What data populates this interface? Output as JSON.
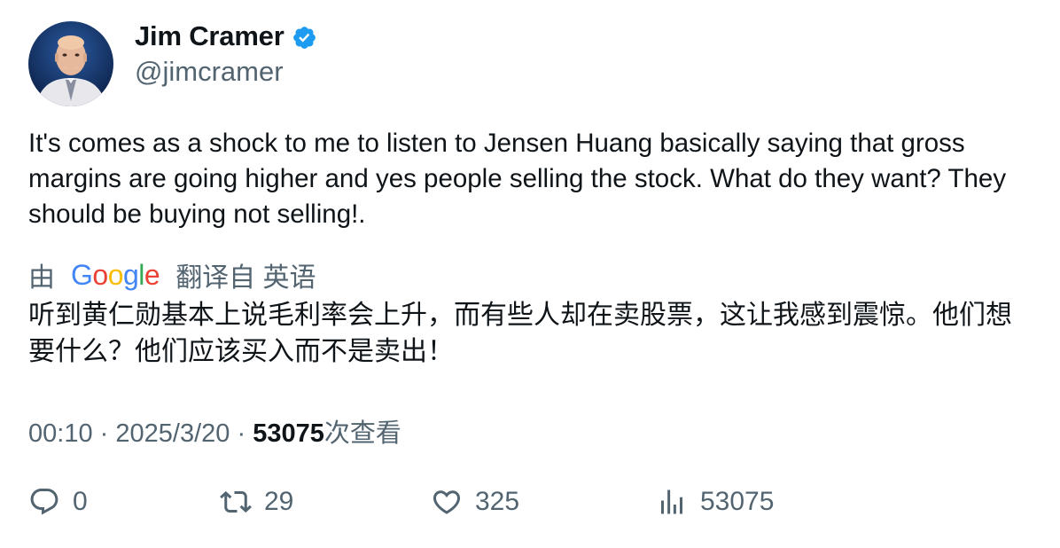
{
  "author": {
    "name": "Jim Cramer",
    "handle": "@jimcramer",
    "verified_icon": "verified-badge-icon",
    "verified_color": "#1d9bf0"
  },
  "tweet": {
    "text": "It's comes as a shock to me to listen to Jensen Huang basically saying that gross margins are going higher and yes people selling the stock. What do they want? They should be buying not selling!."
  },
  "translation": {
    "by_label": "由",
    "provider": "Google",
    "source_label": "翻译自 英语",
    "text": "听到黄仁勋基本上说毛利率会上升，而有些人却在卖股票，这让我感到震惊。他们想要什么？他们应该买入而不是卖出！"
  },
  "meta": {
    "time": "00:10",
    "separator": "·",
    "date": "2025/3/20",
    "views_count": "53075",
    "views_label": "次查看"
  },
  "actions": {
    "reply": {
      "icon": "reply-icon",
      "count": "0"
    },
    "retweet": {
      "icon": "retweet-icon",
      "count": "29"
    },
    "like": {
      "icon": "heart-icon",
      "count": "325"
    },
    "views": {
      "icon": "views-bar-chart-icon",
      "count": "53075"
    }
  },
  "colors": {
    "text_primary": "#0f1419",
    "text_secondary": "#536471",
    "accent": "#1d9bf0"
  }
}
